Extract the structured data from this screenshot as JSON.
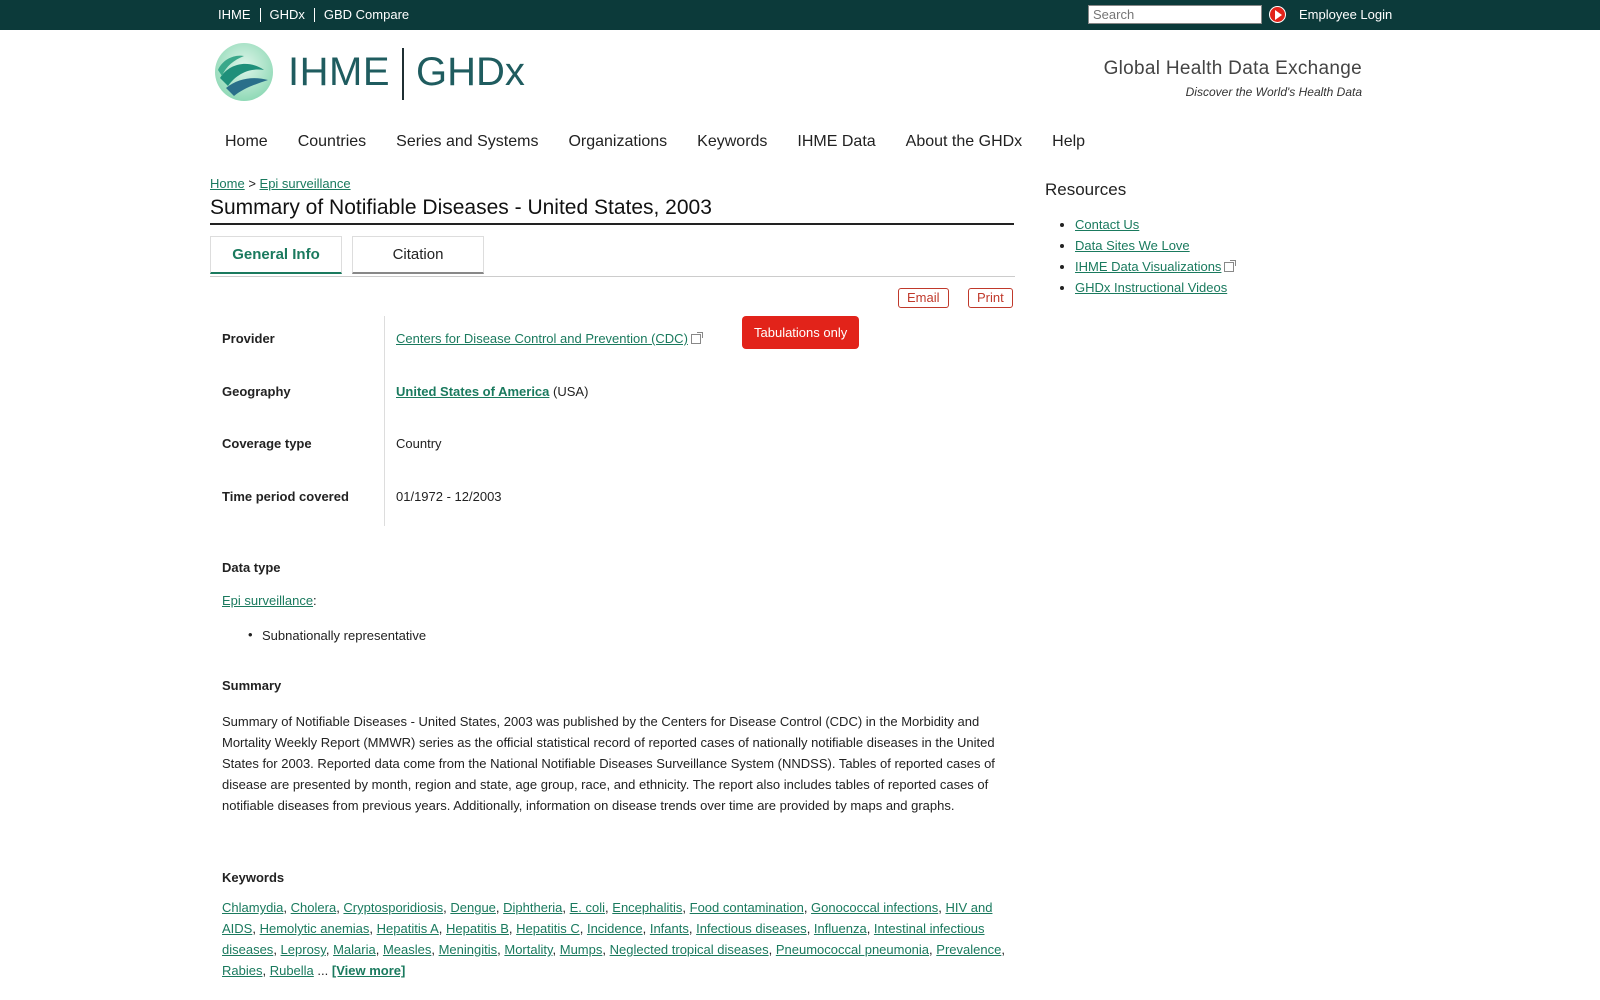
{
  "topbar": {
    "sites": [
      "IHME",
      "GHDx",
      "GBD Compare"
    ],
    "search_placeholder": "Search",
    "login": "Employee Login"
  },
  "header": {
    "logo_ihme": "IHME",
    "logo_ghdx": "GHDx",
    "tagline_title": "Global Health Data Exchange",
    "tagline_sub": "Discover the World's Health Data"
  },
  "nav": [
    "Home",
    "Countries",
    "Series and Systems",
    "Organizations",
    "Keywords",
    "IHME Data",
    "About the GHDx",
    "Help"
  ],
  "breadcrumb": {
    "home": "Home",
    "sep": ">",
    "current": "Epi surveillance"
  },
  "page_title": "Summary of Notifiable Diseases - United States, 2003",
  "tabs": {
    "general": "General Info",
    "citation": "Citation"
  },
  "actions": {
    "email": "Email",
    "print": "Print"
  },
  "info": {
    "provider_label": "Provider",
    "provider_value": "Centers for Disease Control and Prevention (CDC)",
    "provider_badge": "Tabulations only",
    "geography_label": "Geography",
    "geography_value": "United States of America",
    "geography_code": "(USA)",
    "coverage_label": "Coverage type",
    "coverage_value": "Country",
    "time_label": "Time period covered",
    "time_value": "01/1972 - 12/2003"
  },
  "data_type": {
    "heading": "Data type",
    "link": "Epi surveillance",
    "colon": ":",
    "bullet": "Subnationally representative"
  },
  "summary": {
    "heading": "Summary",
    "text": "Summary of Notifiable Diseases - United States, 2003 was published by the Centers for Disease Control (CDC) in the Morbidity and Mortality Weekly Report (MMWR) series as the official statistical record of reported cases of nationally notifiable diseases in the United States for 2003. Reported data come from the National Notifiable Diseases Surveillance System (NNDSS). Tables of reported cases of disease are presented by month, region and state, age group, race, and ethnicity. The report also includes tables of reported cases of notifiable diseases from previous years. Additionally, information on disease trends over time are provided by maps and graphs."
  },
  "keywords": {
    "heading": "Keywords",
    "items": [
      "Chlamydia",
      "Cholera",
      "Cryptosporidiosis",
      "Dengue",
      "Diphtheria",
      "E. coli",
      "Encephalitis",
      "Food contamination",
      "Gonococcal infections",
      "HIV and AIDS",
      "Hemolytic anemias",
      "Hepatitis A",
      "Hepatitis B",
      "Hepatitis C",
      "Incidence",
      "Infants",
      "Infectious diseases",
      "Influenza",
      "Intestinal infectious diseases",
      "Leprosy",
      "Malaria",
      "Measles",
      "Meningitis",
      "Mortality",
      "Mumps",
      "Neglected tropical diseases",
      "Pneumococcal pneumonia",
      "Prevalence",
      "Rabies",
      "Rubella"
    ],
    "ellipsis": "...",
    "view_more": "[View more]"
  },
  "resources": {
    "title": "Resources",
    "links": [
      "Contact Us",
      "Data Sites We Love",
      "IHME Data Visualizations",
      "GHDx Instructional Videos"
    ]
  },
  "colors": {
    "topbar": "#0c3a3a",
    "accent": "#1a7a5e",
    "badge": "#e2231a"
  }
}
